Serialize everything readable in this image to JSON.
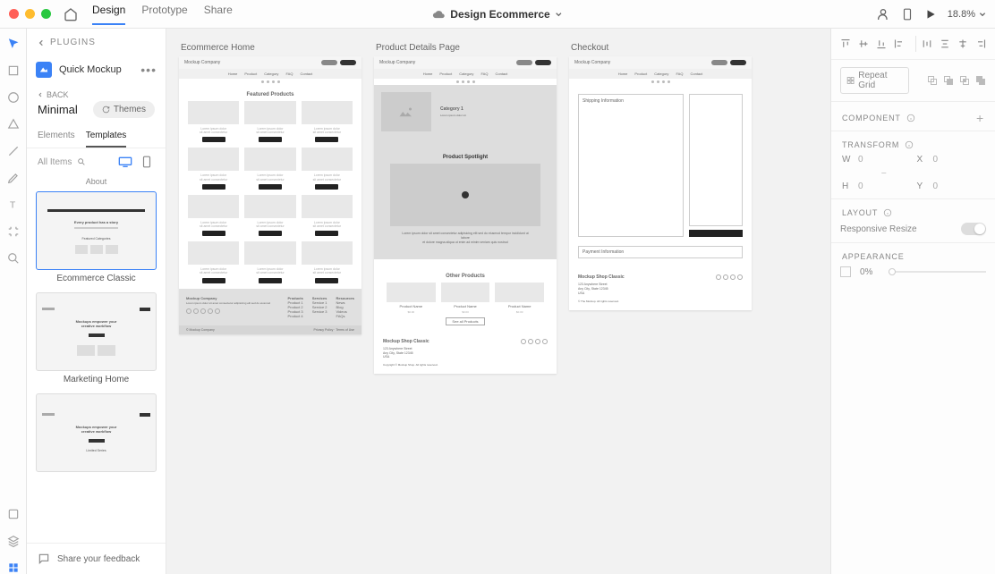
{
  "titlebar": {
    "tabs": [
      "Design",
      "Prototype",
      "Share"
    ],
    "active_tab": "Design",
    "doc_title": "Design Ecommerce",
    "zoom": "18.8%"
  },
  "leftpanel": {
    "plugins_label": "PLUGINS",
    "plugin_name": "Quick Mockup",
    "back_label": "BACK",
    "theme_name": "Minimal",
    "themes_btn": "Themes",
    "subtabs": [
      "Elements",
      "Templates"
    ],
    "active_subtab": "Templates",
    "filter_label": "All Items",
    "about_label": "About",
    "templates": [
      {
        "name": "Ecommerce Classic",
        "selected": true
      },
      {
        "name": "Marketing Home",
        "selected": false
      },
      {
        "name": "",
        "selected": false
      }
    ],
    "feedback": "Share your feedback"
  },
  "canvas": {
    "artboards": [
      {
        "title": "Ecommerce Home",
        "sections": {
          "featured": "Featured Products",
          "company": "Mockup Company",
          "nav": [
            "Home",
            "Product",
            "Category",
            "FAQ",
            "Contact"
          ],
          "footer_cols": [
            "Products",
            "Services",
            "Resources"
          ]
        }
      },
      {
        "title": "Product Details Page",
        "sections": {
          "category": "Category 1",
          "spotlight": "Product Spotlight",
          "other": "Other Products",
          "footer_name": "Mockup Shop Classic",
          "seeall": "See all Products"
        }
      },
      {
        "title": "Checkout",
        "sections": {
          "shipping": "Shipping Information",
          "payment": "Payment Information",
          "footer_name": "Mockup Shop Classic"
        }
      }
    ]
  },
  "rightpanel": {
    "repeat_grid": "Repeat Grid",
    "component": "COMPONENT",
    "transform": "TRANSFORM",
    "w_label": "W",
    "w_val": "0",
    "x_label": "X",
    "x_val": "0",
    "h_label": "H",
    "h_val": "0",
    "y_label": "Y",
    "y_val": "0",
    "layout": "LAYOUT",
    "responsive": "Responsive Resize",
    "appearance": "APPEARANCE",
    "opacity": "0%"
  }
}
